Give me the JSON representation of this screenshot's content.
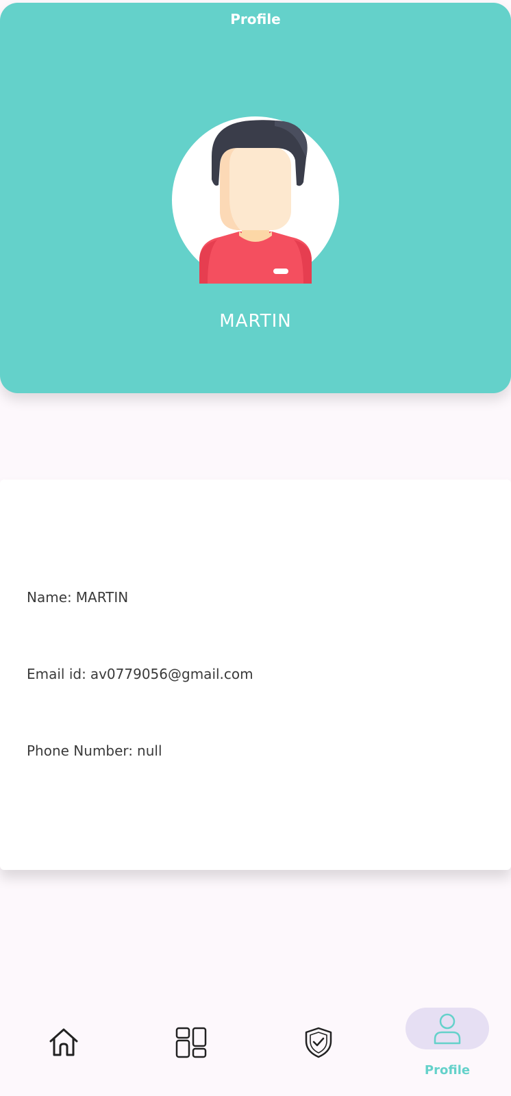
{
  "header": {
    "title": "Profile",
    "profile_name": "MARTIN",
    "background_color": "#64d1ca",
    "avatar_icon": "user-avatar-illustration"
  },
  "details": {
    "name_label": "Name:",
    "name_value": "MARTIN",
    "email_label": "Email id:",
    "email_value": "av0779056@gmail.com",
    "phone_label": "Phone Number:",
    "phone_value": "null"
  },
  "bottom_nav": {
    "items": [
      {
        "icon": "home-icon",
        "label": ""
      },
      {
        "icon": "dashboard-icon",
        "label": ""
      },
      {
        "icon": "shield-check-icon",
        "label": ""
      },
      {
        "icon": "profile-icon",
        "label": "Profile",
        "active": true
      }
    ],
    "active_color": "#64d1ca",
    "active_pill_color": "#e6dff3"
  }
}
